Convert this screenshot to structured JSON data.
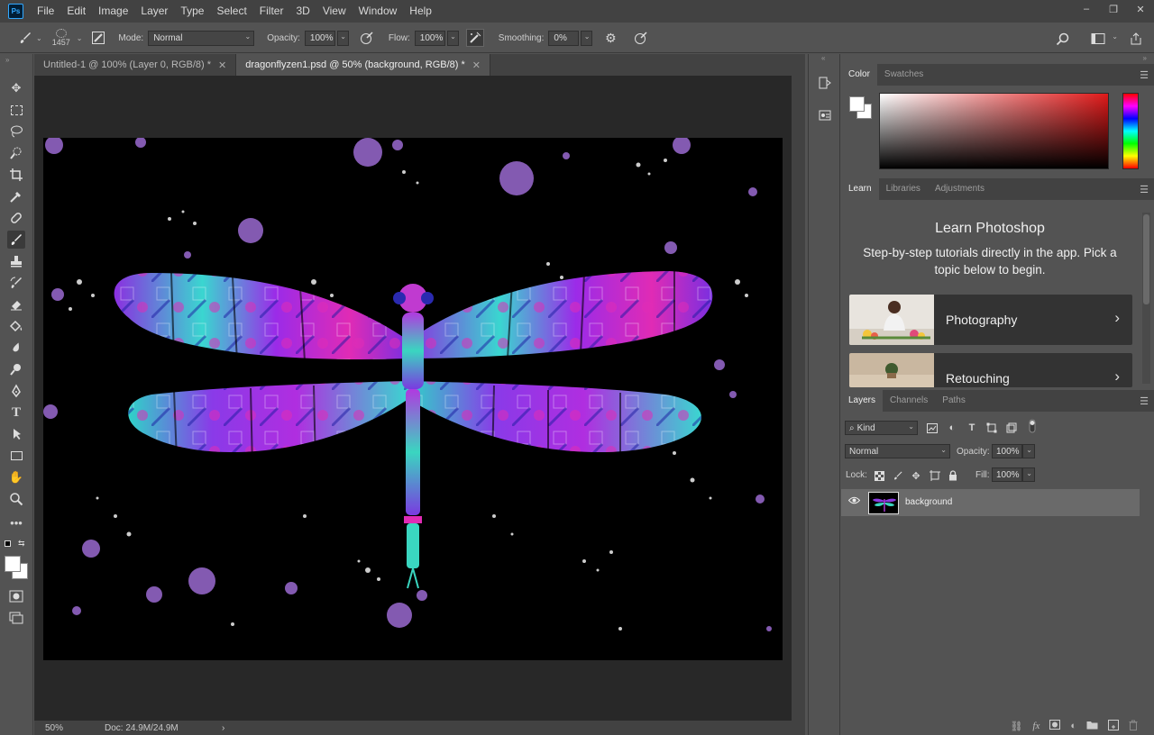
{
  "app": {
    "logo": "Ps"
  },
  "menu": [
    "File",
    "Edit",
    "Image",
    "Layer",
    "Type",
    "Select",
    "Filter",
    "3D",
    "View",
    "Window",
    "Help"
  ],
  "window_controls": {
    "minimize": "–",
    "restore": "❐",
    "close": "✕"
  },
  "options": {
    "brush_size": "1457",
    "mode_label": "Mode:",
    "mode_value": "Normal",
    "opacity_label": "Opacity:",
    "opacity_value": "100%",
    "flow_label": "Flow:",
    "flow_value": "100%",
    "smoothing_label": "Smoothing:",
    "smoothing_value": "0%"
  },
  "tabs": [
    {
      "label": "Untitled-1 @ 100% (Layer 0, RGB/8) *",
      "close": "✕"
    },
    {
      "label": "dragonflyzen1.psd @ 50% (background, RGB/8) *",
      "close": "✕"
    }
  ],
  "status": {
    "zoom": "50%",
    "doc": "Doc: 24.9M/24.9M",
    "arrow": "›"
  },
  "color_panel": {
    "tabs": [
      "Color",
      "Swatches"
    ]
  },
  "learn_panel": {
    "tabs": [
      "Learn",
      "Libraries",
      "Adjustments"
    ],
    "title": "Learn Photoshop",
    "description": "Step-by-step tutorials directly in the app. Pick a topic below to begin.",
    "cards": [
      {
        "label": "Photography",
        "chevron": "›"
      },
      {
        "label": "Retouching",
        "chevron": "›"
      }
    ]
  },
  "layers_panel": {
    "tabs": [
      "Layers",
      "Channels",
      "Paths"
    ],
    "filter_label": "Kind",
    "blend_mode": "Normal",
    "opacity_label": "Opacity:",
    "opacity_value": "100%",
    "lock_label": "Lock:",
    "fill_label": "Fill:",
    "fill_value": "100%",
    "layers": [
      {
        "name": "background",
        "visible": true
      }
    ]
  },
  "colors": {
    "accent": "#31a8ff",
    "panel_bg": "#535353",
    "dark_bg": "#424242",
    "canvas_bg": "#282828"
  }
}
